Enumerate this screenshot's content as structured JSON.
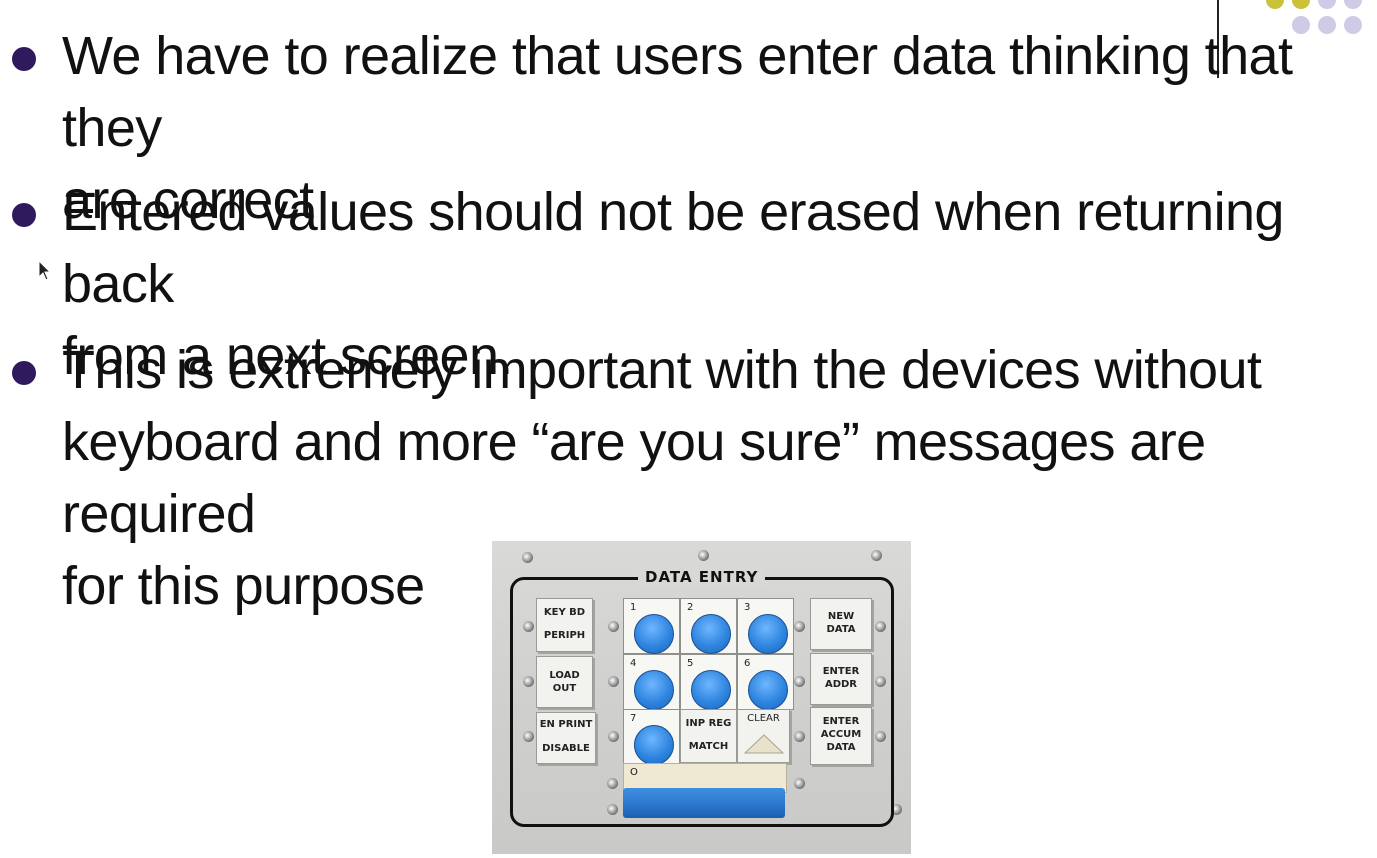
{
  "slide": {
    "bullets": [
      {
        "line1": "We have to realize that users enter data thinking that they",
        "line2": "are correct"
      },
      {
        "line1": "Entered values should  not be erased when returning back",
        "line2": "from a next screen."
      },
      {
        "line1": "This is extremely important with the devices without",
        "line2": "keyboard and more “are you sure” messages are required",
        "line3": "for this purpose"
      }
    ],
    "bullet_color": "#2e1a5c",
    "deco_colors": [
      "#c9c23a",
      "#cfcbe6"
    ]
  },
  "photo": {
    "panel_title": "DATA ENTRY",
    "left_keys": [
      {
        "top": "KEY BD",
        "bottom": "PERIPH"
      },
      {
        "top": "LOAD",
        "bottom": "OUT"
      },
      {
        "top": "EN PRINT",
        "bottom": "DISABLE"
      }
    ],
    "number_keys": [
      "1",
      "2",
      "3",
      "4",
      "5",
      "6",
      "7"
    ],
    "inp_reg_key": {
      "top": "INP REG",
      "bottom": "MATCH"
    },
    "clear_key": "CLEAR",
    "zero_label": "O",
    "right_keys": [
      {
        "top": "NEW",
        "bottom": "DATA"
      },
      {
        "top": "ENTER",
        "bottom": "ADDR"
      },
      {
        "top": "ENTER",
        "middle": "ACCUM",
        "bottom": "DATA"
      }
    ]
  }
}
